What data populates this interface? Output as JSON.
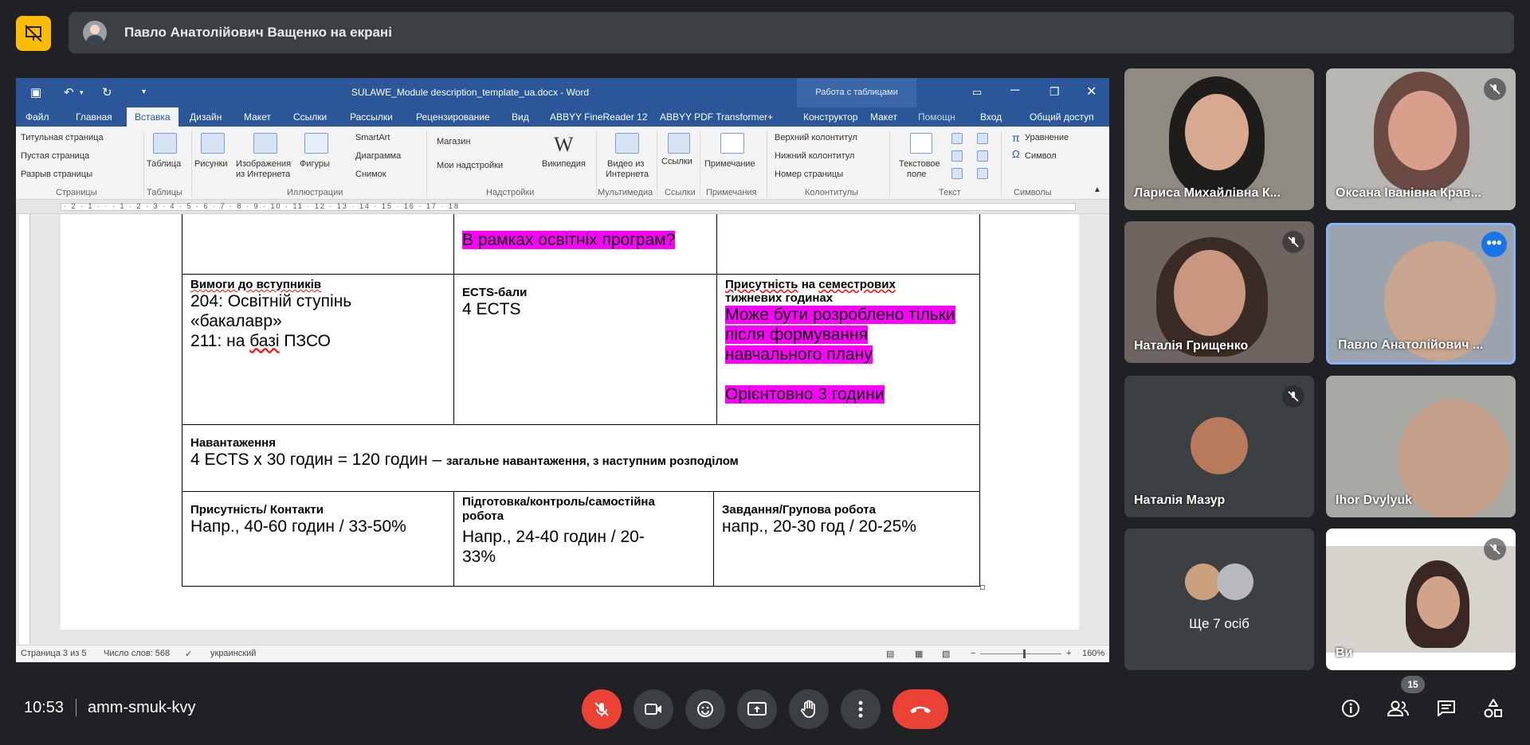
{
  "banner": {
    "presenter_text": "Павло Анатолійович Ващенко на екрані"
  },
  "word": {
    "title": "SULAWE_Module description_template_ua.docx - Word",
    "context_tab": "Работа с таблицами",
    "help": "Помощн",
    "login": "Вход",
    "share": "Общий доступ",
    "tabs": [
      "Файл",
      "Главная",
      "Вставка",
      "Дизайн",
      "Макет",
      "Ссылки",
      "Рассылки",
      "Рецензирование",
      "Вид",
      "ABBYY FineReader 12",
      "ABBYY PDF Transformer+",
      "Конструктор",
      "Макет"
    ],
    "ribbon": {
      "pages": [
        "Титульная страница",
        "Пустая страница",
        "Разрыв страницы"
      ],
      "table": "Таблица",
      "pictures": "Рисунки",
      "online_pics": [
        "Изображения",
        "из Интернета"
      ],
      "shapes": "Фигуры",
      "smartart": "SmartArt",
      "chart": "Диаграмма",
      "snapshot": "Снимок",
      "store": "Магазин",
      "my_addins": "Мои надстройки",
      "wikipedia": "Википедия",
      "video": [
        "Видео из",
        "Интернета"
      ],
      "links": "Ссылки",
      "comment": "Примечание",
      "header": "Верхний колонтитул",
      "footer": "Нижний колонтитул",
      "page_num": "Номер страницы",
      "textbox": [
        "Текстовое",
        "поле"
      ],
      "equation": "Уравнение",
      "symbol": "Символ",
      "groups": [
        "Страницы",
        "Таблицы",
        "Иллюстрации",
        "Надстройки",
        "Мультимедиа",
        "Ссылки",
        "Примечания",
        "Колонтитулы",
        "Текст",
        "Символы"
      ]
    },
    "ruler_text": "· 2 · 1 · ·  · 1 · 2 · 3 · 4 · 5 · 6 · 7 · 8 · 9 · 10 · 11 · 12 · 13 · 14 · 15 · 16 · 17 · 18",
    "doc": {
      "row0_mid": "В рамках освітніх програм?",
      "req_title": "Вимоги до вступників",
      "req_l1": "204: Освітній ступінь",
      "req_l2": "«бакалавр»",
      "req_l3a": "211: на ",
      "req_l3b": "базі",
      "req_l3c": " ПЗСО",
      "ects_title": "ECTS-бали",
      "ects_val": "4 ECTS",
      "pres_title_a": "Присутність",
      "pres_title_b": " на ",
      "pres_title_c": "семестрових",
      "pres_title_d": "тижневих годинах",
      "pres_l1": "Може бути розроблено тільки",
      "pres_l2": "після формування",
      "pres_l3": "навчального плану",
      "pres_l4": "Орієнтовно 3 години",
      "load_title": "Навантаження",
      "load_main": "4 ECTS x 30 годин = 120 годин – ",
      "load_tail": "загальне навантаження, з наступним розподілом",
      "c1_title": "Присутність/ Контакти",
      "c1_val": "Напр., 40-60 годин / 33-50%",
      "c2_title_1": "Підготовка/контроль/самостійна",
      "c2_title_2": "робота",
      "c2_val_1": "Напр., 24-40 годин / 20-",
      "c2_val_2": "33%",
      "c3_title": "Завдання/Групова робота",
      "c3_val": "напр., 20-30 год / 20-25%"
    },
    "status": {
      "page": "Страница 3 из 5",
      "words": "Число слов: 568",
      "lang": "украинский",
      "zoom": "160%"
    }
  },
  "participants": [
    {
      "name": "Лариса Михайлівна К..."
    },
    {
      "name": "Оксана Іванівна Крав..."
    },
    {
      "name": "Наталія Грищенко"
    },
    {
      "name": "Павло Анатолійович ..."
    },
    {
      "name": "Наталія Мазур"
    },
    {
      "name": "Ihor Dvylyuk"
    },
    {
      "name": "Ще 7 осіб"
    },
    {
      "name": "Ви"
    }
  ],
  "bottom": {
    "time": "10:53",
    "meeting_code": "amm-smuk-kvy",
    "people_count": "15"
  },
  "colors": {
    "highlight": "#ff00ff",
    "word_blue": "#2b579a",
    "end_call": "#ea4335",
    "present": "#fbbc04"
  }
}
